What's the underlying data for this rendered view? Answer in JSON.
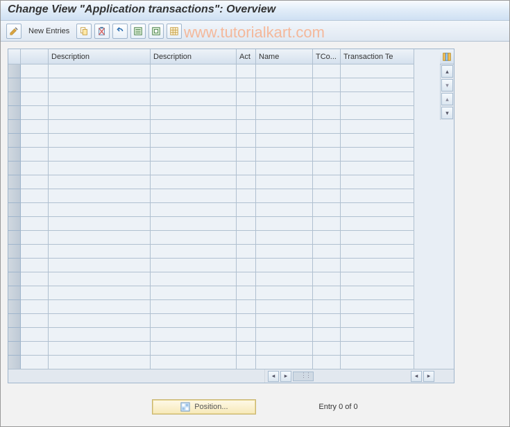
{
  "title": "Change View \"Application transactions\": Overview",
  "watermark": "www.tutorialkart.com",
  "toolbar": {
    "new_entries": "New Entries"
  },
  "table": {
    "columns": {
      "empty1": "",
      "desc1": "Description",
      "desc2": "Description",
      "act": "Act",
      "name": "Name",
      "tco": "TCo...",
      "tt": "Transaction Te"
    },
    "row_count": 22
  },
  "footer": {
    "position_label": "Position...",
    "status": "Entry 0 of 0"
  }
}
